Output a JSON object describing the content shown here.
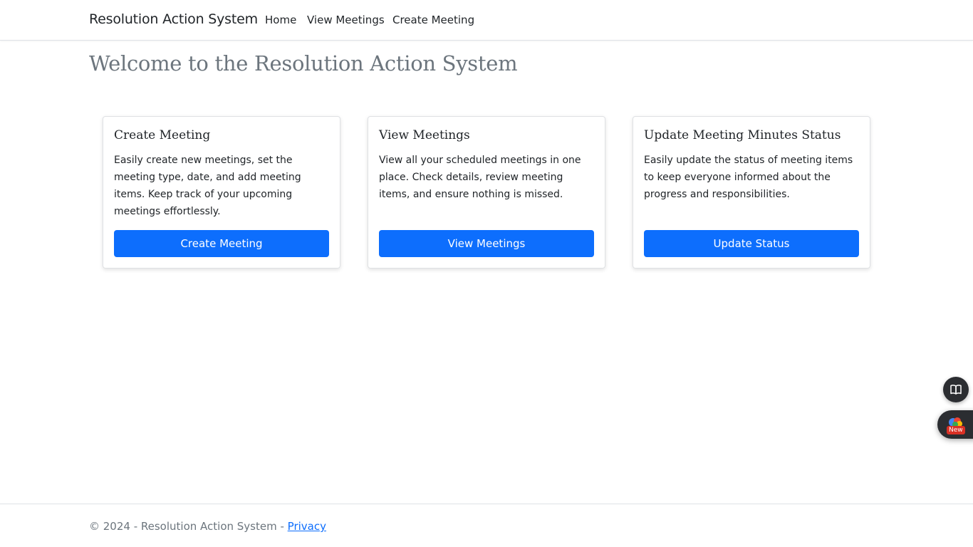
{
  "navbar": {
    "brand": "Resolution Action System",
    "links": [
      "Home",
      "View Meetings",
      "Create Meeting"
    ]
  },
  "main": {
    "title": "Welcome to the Resolution Action System",
    "cards": [
      {
        "title": "Create Meeting",
        "text": "Easily create new meetings, set the meeting type, date, and add meeting items. Keep track of your upcoming meetings effortlessly.",
        "button": "Create Meeting"
      },
      {
        "title": "View Meetings",
        "text": "View all your scheduled meetings in one place. Check details, review meeting items, and ensure nothing is missed.",
        "button": "View Meetings"
      },
      {
        "title": "Update Meeting Minutes Status",
        "text": "Easily update the status of meeting items to keep everyone informed about the progress and responsibilities.",
        "button": "Update Status"
      }
    ]
  },
  "side_widgets": {
    "reader_icon": "book-icon",
    "ai_icon": "assistant-icon",
    "new_badge": "New"
  },
  "footer": {
    "text": "© 2024 - Resolution Action System - ",
    "privacy_link": "Privacy"
  },
  "colors": {
    "primary": "#0d6efd",
    "muted": "#6c757d",
    "text": "#212529"
  }
}
